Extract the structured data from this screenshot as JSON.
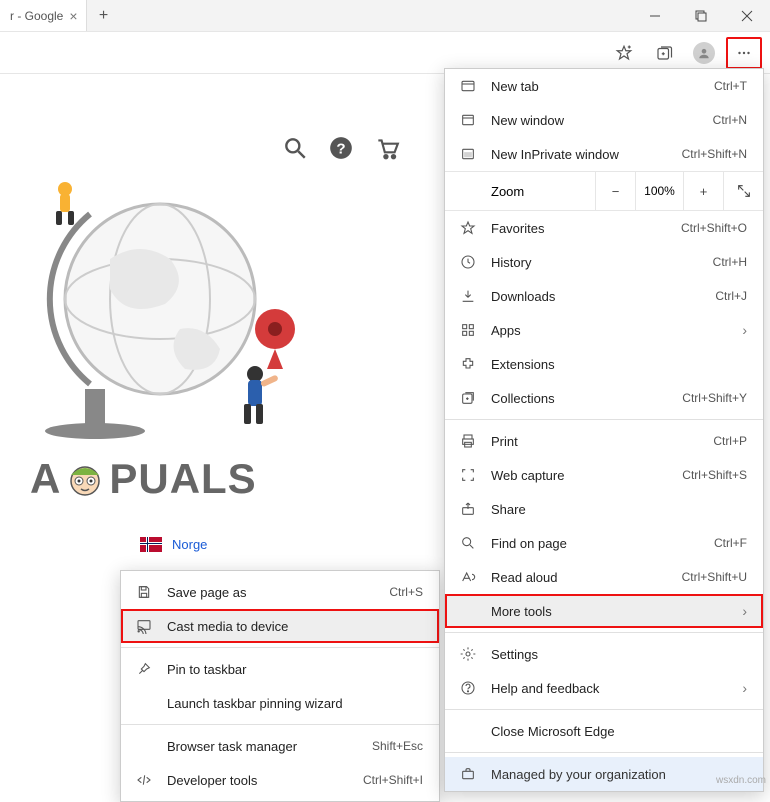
{
  "window": {
    "tab_title": "r - Google",
    "minimize": "—",
    "close": "✕"
  },
  "toolbar": {},
  "page": {
    "norge_label": "Norge",
    "logo_a1": "A",
    "logo_rest": "PUALS"
  },
  "menu": {
    "new_tab": {
      "label": "New tab",
      "shortcut": "Ctrl+T"
    },
    "new_window": {
      "label": "New window",
      "shortcut": "Ctrl+N"
    },
    "new_inprivate": {
      "label": "New InPrivate window",
      "shortcut": "Ctrl+Shift+N"
    },
    "zoom": {
      "label": "Zoom",
      "value": "100%"
    },
    "favorites": {
      "label": "Favorites",
      "shortcut": "Ctrl+Shift+O"
    },
    "history": {
      "label": "History",
      "shortcut": "Ctrl+H"
    },
    "downloads": {
      "label": "Downloads",
      "shortcut": "Ctrl+J"
    },
    "apps": {
      "label": "Apps"
    },
    "extensions": {
      "label": "Extensions"
    },
    "collections": {
      "label": "Collections",
      "shortcut": "Ctrl+Shift+Y"
    },
    "print": {
      "label": "Print",
      "shortcut": "Ctrl+P"
    },
    "web_capture": {
      "label": "Web capture",
      "shortcut": "Ctrl+Shift+S"
    },
    "share": {
      "label": "Share"
    },
    "find": {
      "label": "Find on page",
      "shortcut": "Ctrl+F"
    },
    "read_aloud": {
      "label": "Read aloud",
      "shortcut": "Ctrl+Shift+U"
    },
    "more_tools": {
      "label": "More tools"
    },
    "settings": {
      "label": "Settings"
    },
    "help": {
      "label": "Help and feedback"
    },
    "close_edge": {
      "label": "Close Microsoft Edge"
    },
    "managed": {
      "label": "Managed by your organization"
    }
  },
  "submenu": {
    "save_page": {
      "label": "Save page as",
      "shortcut": "Ctrl+S"
    },
    "cast": {
      "label": "Cast media to device"
    },
    "pin": {
      "label": "Pin to taskbar"
    },
    "launch_pin": {
      "label": "Launch taskbar pinning wizard"
    },
    "task_mgr": {
      "label": "Browser task manager",
      "shortcut": "Shift+Esc"
    },
    "dev_tools": {
      "label": "Developer tools",
      "shortcut": "Ctrl+Shift+I"
    }
  },
  "watermark": "wsxdn.com"
}
